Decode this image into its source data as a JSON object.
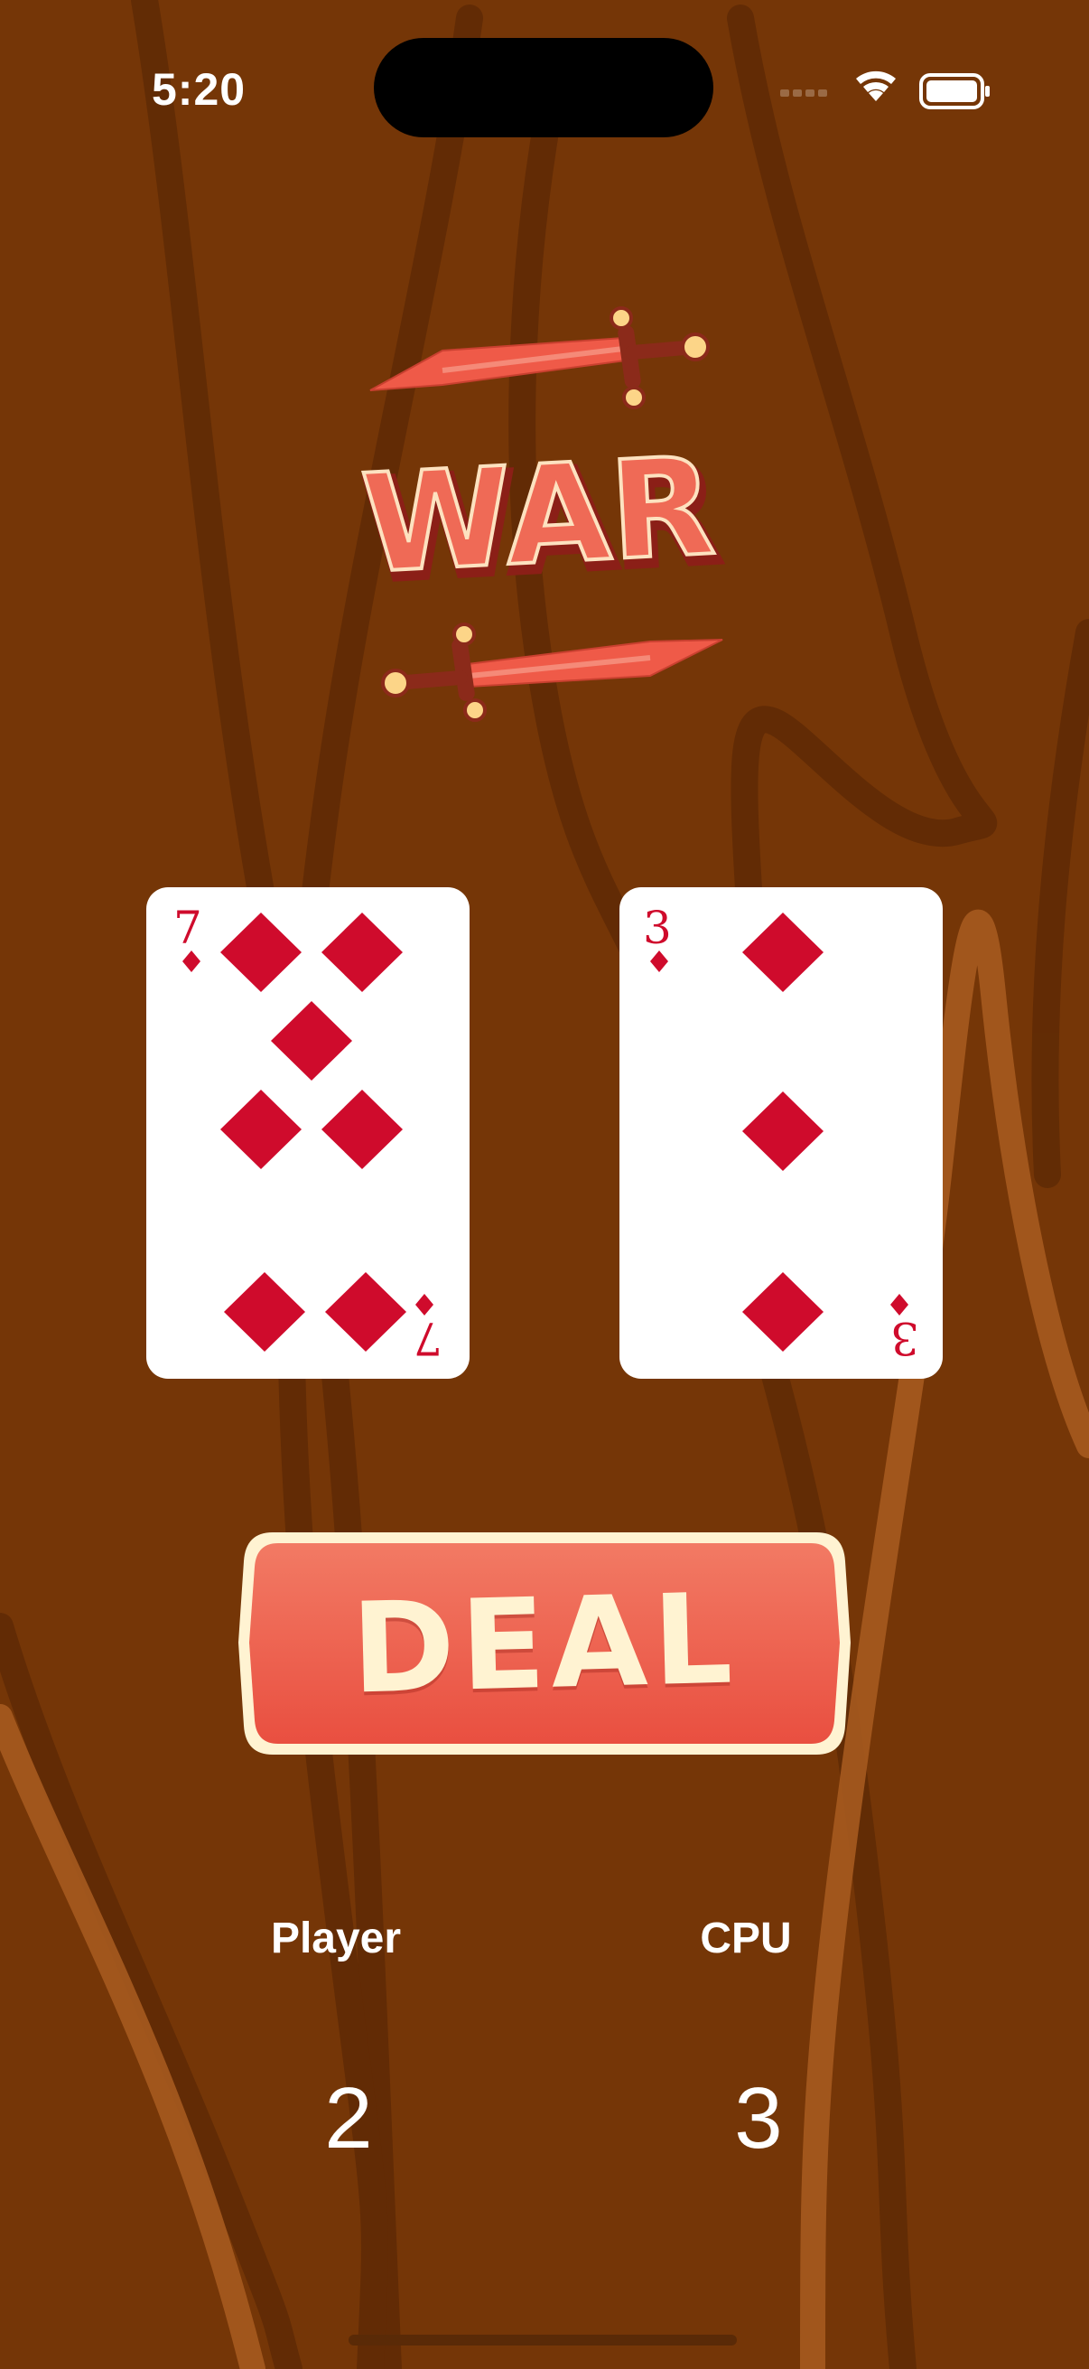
{
  "status_bar": {
    "time": "5:20",
    "icons": [
      "signal-icon",
      "wifi-icon",
      "battery-icon"
    ]
  },
  "logo": {
    "text": "WAR",
    "icon": "crossed-swords-icon"
  },
  "cards": {
    "player": {
      "rank": "7",
      "suit": "diamonds"
    },
    "cpu": {
      "rank": "3",
      "suit": "diamonds"
    }
  },
  "deal_button": {
    "label": "DEAL"
  },
  "scores": {
    "player_label": "Player",
    "player_value": "2",
    "cpu_label": "CPU",
    "cpu_value": "3"
  },
  "colors": {
    "background": "#753607",
    "accent_red": "#ee5a4a",
    "cream": "#fff3d2",
    "suit_red": "#cf0b2c"
  }
}
